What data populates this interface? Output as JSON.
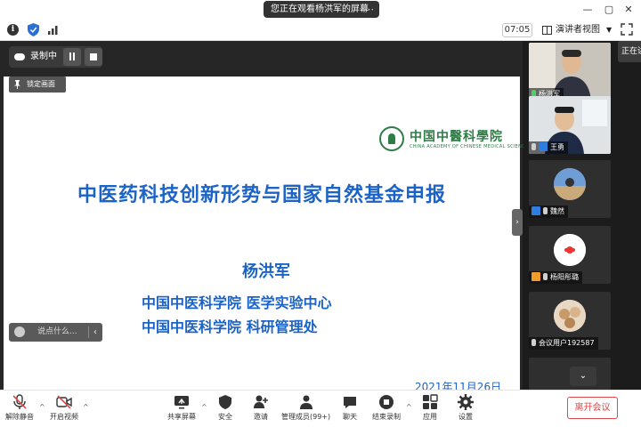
{
  "titlebar": {
    "share_notice": "您正在观看杨洪军的屏幕",
    "share_menu": "⋯",
    "minimize": "—",
    "restore": "▢",
    "close": "✕"
  },
  "toprow": {
    "timer": "07:05",
    "view_mode": "演讲者视图",
    "speaking_label": "正在讲话"
  },
  "recording": {
    "label": "录制中"
  },
  "lock_screen": "锁定画面",
  "chat_placeholder": "说点什么...",
  "slide": {
    "title": "中医药科技创新形势与国家自然基金申报",
    "presenter": "杨洪军",
    "org_lines": [
      "中国中医科学院  医学实验中心",
      "中国中医科学院  科研管理处"
    ],
    "date": "2021年11月26日",
    "logo_cn": "中国中醫科學院",
    "logo_en": "CHINA ACADEMY OF CHINESE MEDICAL SCIENCES"
  },
  "participants": [
    {
      "name": "杨洪军",
      "type": "video",
      "mic": "on",
      "role": "host"
    },
    {
      "name": "王勇",
      "type": "video",
      "mic": "off",
      "role": "host"
    },
    {
      "name": "魏然",
      "type": "avatar",
      "mic": "off",
      "role": "host"
    },
    {
      "name": "杨阳彤璐",
      "type": "avatar",
      "mic": "off",
      "role": "guest"
    },
    {
      "name": "会议用户192587",
      "type": "avatar",
      "mic": "off",
      "role": "guest"
    }
  ],
  "toolbar": {
    "unmute": "解除静音",
    "start_video": "开启视频",
    "share_screen": "共享屏幕",
    "security": "安全",
    "invite": "邀请",
    "manage_members": "管理成员(99+)",
    "chat": "聊天",
    "stop_recording": "结束录制",
    "apps": "应用",
    "settings": "设置",
    "leave": "离开会议"
  },
  "colors": {
    "slide_blue": "#1b63c6",
    "logo_green": "#2f7d46",
    "leave_red": "#e04848",
    "mic_active": "#4bd16b"
  }
}
